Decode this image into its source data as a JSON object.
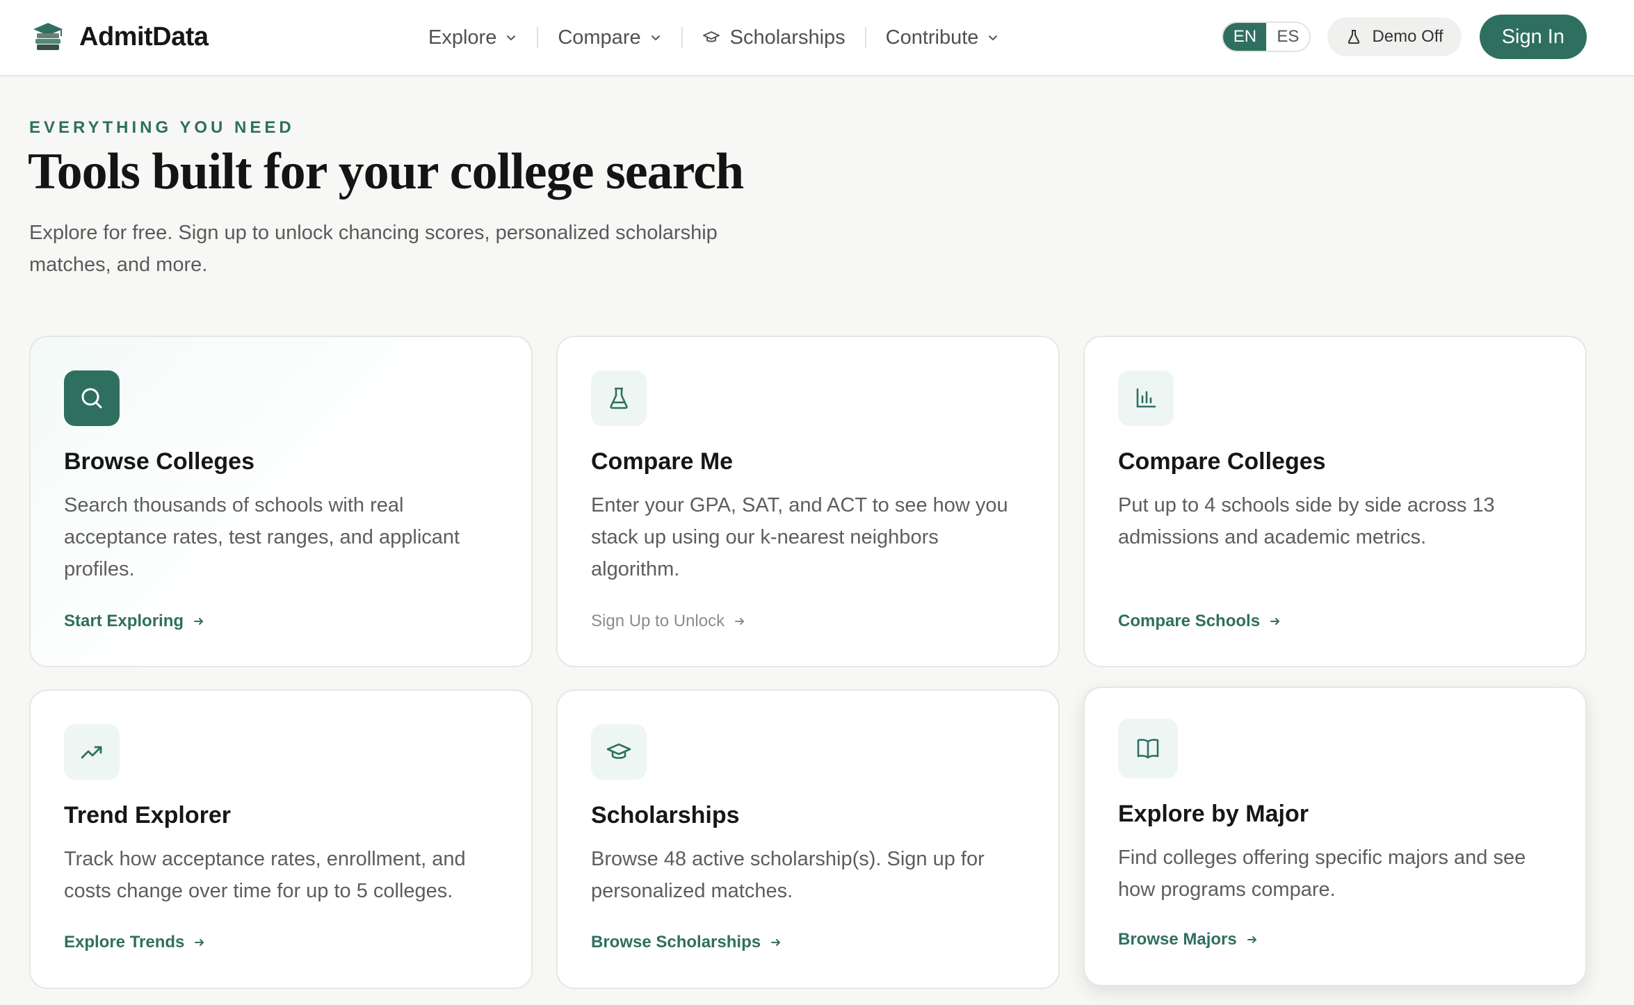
{
  "brand": {
    "name": "AdmitData"
  },
  "nav": {
    "items": [
      {
        "label": "Explore",
        "has_menu": true
      },
      {
        "label": "Compare",
        "has_menu": true
      },
      {
        "label": "Scholarships",
        "icon": "graduation-cap-icon",
        "has_menu": false
      },
      {
        "label": "Contribute",
        "has_menu": true
      }
    ]
  },
  "header_controls": {
    "lang_active": "EN",
    "lang_inactive": "ES",
    "demo_label": "Demo Off",
    "signin_label": "Sign In"
  },
  "hero": {
    "eyebrow": "EVERYTHING YOU NEED",
    "title": "Tools built for your college search",
    "subtitle": "Explore for free. Sign up to unlock chancing scores, personalized scholarship matches, and more."
  },
  "cards": [
    {
      "title": "Browse Colleges",
      "desc": "Search thousands of schools with real acceptance rates, test ranges, and applicant profiles.",
      "link": "Start Exploring",
      "icon": "search-icon"
    },
    {
      "title": "Compare Me",
      "desc": "Enter your GPA, SAT, and ACT to see how you stack up using our k-nearest neighbors algorithm.",
      "link": "Sign Up to Unlock",
      "icon": "flask-icon"
    },
    {
      "title": "Compare Colleges",
      "desc": "Put up to 4 schools side by side across 13 admissions and academic metrics.",
      "link": "Compare Schools",
      "icon": "bar-chart-icon"
    },
    {
      "title": "Trend Explorer",
      "desc": "Track how acceptance rates, enrollment, and costs change over time for up to 5 colleges.",
      "link": "Explore Trends",
      "icon": "trending-up-icon"
    },
    {
      "title": "Scholarships",
      "desc": "Browse 48 active scholarship(s). Sign up for personalized matches.",
      "link": "Browse Scholarships",
      "icon": "graduation-cap-icon"
    },
    {
      "title": "Explore by Major",
      "desc": "Find colleges offering specific majors and see how programs compare.",
      "link": "Browse Majors",
      "icon": "book-open-icon"
    }
  ],
  "colors": {
    "accent": "#2f6f60",
    "accent_tint": "#eef6f3",
    "background": "#f7f7f5"
  }
}
